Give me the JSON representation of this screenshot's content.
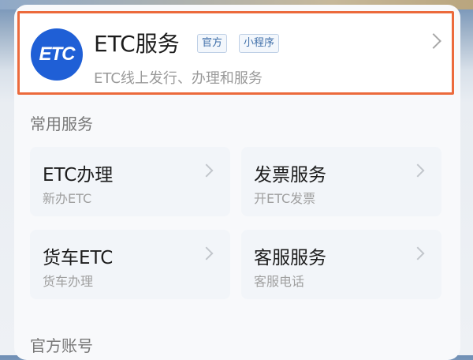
{
  "header": {
    "logo_text": "ETC",
    "title": "ETC服务",
    "tags": [
      "官方",
      "小程序"
    ],
    "subtitle": "ETC线上发行、办理和服务"
  },
  "sections": {
    "common": "常用服务",
    "official": "官方账号"
  },
  "services": [
    {
      "name": "ETC办理",
      "desc": "新办ETC"
    },
    {
      "name": "发票服务",
      "desc": "开ETC发票"
    },
    {
      "name": "货车ETC",
      "desc": "货车办理"
    },
    {
      "name": "客服服务",
      "desc": "客服电话"
    }
  ],
  "colors": {
    "accent_border": "#ec6a3c",
    "logo_blue": "#1f5fd6"
  },
  "icons": {
    "chevron": "chevron-right-icon"
  }
}
